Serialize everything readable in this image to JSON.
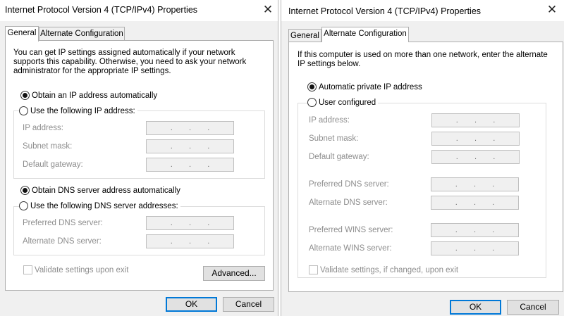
{
  "left": {
    "title": "Internet Protocol Version 4 (TCP/IPv4) Properties",
    "close_symbol": "✕",
    "tabs": [
      "General",
      "Alternate Configuration"
    ],
    "description": "You can get IP settings assigned automatically if your network supports this capability. Otherwise, you need to ask your network administrator for the appropriate IP settings.",
    "ip_auto_label": "Obtain an IP address automatically",
    "ip_manual_label": "Use the following IP address:",
    "ip_fields": [
      "IP address:",
      "Subnet mask:",
      "Default gateway:"
    ],
    "dns_auto_label": "Obtain DNS server address automatically",
    "dns_manual_label": "Use the following DNS server addresses:",
    "dns_fields": [
      "Preferred DNS server:",
      "Alternate DNS server:"
    ],
    "validate_label": "Validate settings upon exit",
    "advanced_label": "Advanced...",
    "ok_label": "OK",
    "cancel_label": "Cancel"
  },
  "right": {
    "title": "Internet Protocol Version 4 (TCP/IPv4) Properties",
    "close_symbol": "✕",
    "tabs": [
      "General",
      "Alternate Configuration"
    ],
    "description": "If this computer is used on more than one network, enter the alternate IP settings below.",
    "auto_private_label": "Automatic private IP address",
    "user_configured_label": "User configured",
    "ip_fields": [
      "IP address:",
      "Subnet mask:",
      "Default gateway:"
    ],
    "dns_fields": [
      "Preferred DNS server:",
      "Alternate DNS server:"
    ],
    "wins_fields": [
      "Preferred WINS server:",
      "Alternate WINS server:"
    ],
    "validate_label": "Validate settings, if changed, upon exit",
    "ok_label": "OK",
    "cancel_label": "Cancel"
  },
  "ip_dot": "."
}
